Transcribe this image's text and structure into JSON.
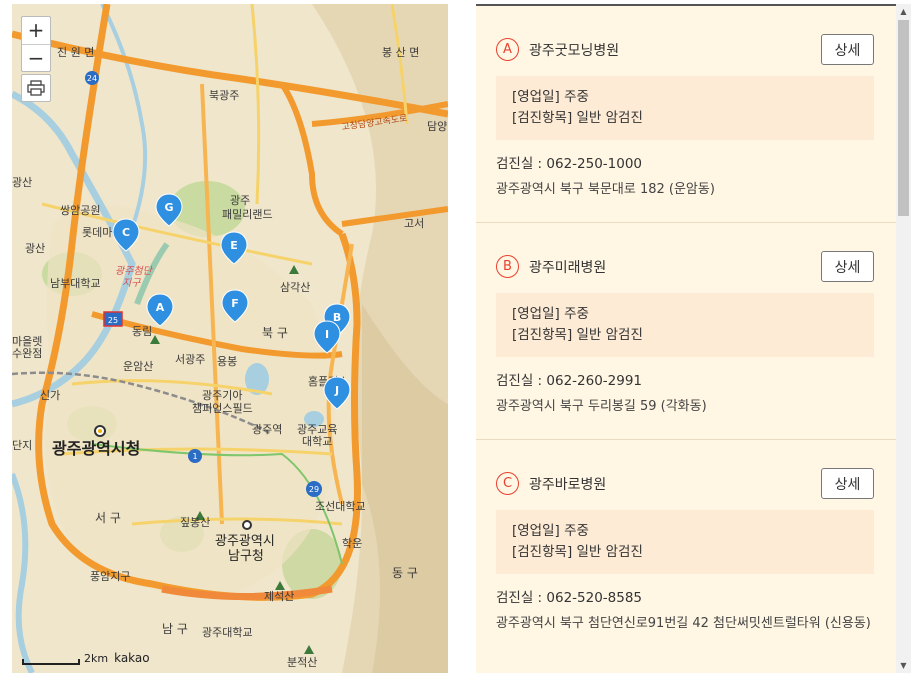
{
  "map": {
    "zoom_in": "+",
    "zoom_out": "−",
    "scale_label": "2km",
    "provider": "kakao",
    "labels": [
      {
        "text": "진 원 면"
      },
      {
        "text": "봉 산 면"
      },
      {
        "text": "북광주"
      },
      {
        "text": "고창담양고속도로"
      },
      {
        "text": "담양"
      },
      {
        "text": "쌍암공원"
      },
      {
        "text": "광주"
      },
      {
        "text": "패밀리랜드"
      },
      {
        "text": "롯데마트"
      },
      {
        "text": "고서"
      },
      {
        "text": "광주첨단"
      },
      {
        "text": "지구"
      },
      {
        "text": "남부대학교"
      },
      {
        "text": "삼각산"
      },
      {
        "text": "동림"
      },
      {
        "text": "북 구"
      },
      {
        "text": "서광주"
      },
      {
        "text": "용봉"
      },
      {
        "text": "운암산"
      },
      {
        "text": "홈플러스"
      },
      {
        "text": "광주기아"
      },
      {
        "text": "챔피언스필드"
      },
      {
        "text": "광주역"
      },
      {
        "text": "광주교육"
      },
      {
        "text": "대학교"
      },
      {
        "text": "광주광역시청"
      },
      {
        "text": "서 구"
      },
      {
        "text": "조선대학교"
      },
      {
        "text": "짚봉산"
      },
      {
        "text": "광주광역시"
      },
      {
        "text": "남구청"
      },
      {
        "text": "학운"
      },
      {
        "text": "풍암지구"
      },
      {
        "text": "동 구"
      },
      {
        "text": "제석산"
      },
      {
        "text": "남 구"
      },
      {
        "text": "광주대학교"
      },
      {
        "text": "분적산"
      },
      {
        "text": "신가"
      },
      {
        "text": "광산"
      },
      {
        "text": "마을렛"
      },
      {
        "text": "수완점"
      },
      {
        "text": "광산"
      },
      {
        "text": "단지"
      }
    ],
    "route_numbers": [
      "24",
      "25",
      "1",
      "29"
    ],
    "markers": [
      "A",
      "B",
      "C",
      "E",
      "F",
      "G",
      "I",
      "J"
    ]
  },
  "hospitals": [
    {
      "marker": "A",
      "name": "광주굿모닝병원",
      "detail_label": "상세",
      "open_days": "[영업일] 주중",
      "exam_items": "[검진항목] 일반 암검진",
      "phone": "검진실 :  062-250-1000",
      "address": "광주광역시 북구 북문대로 182 (운암동)"
    },
    {
      "marker": "B",
      "name": "광주미래병원",
      "detail_label": "상세",
      "open_days": "[영업일] 주중",
      "exam_items": "[검진항목] 일반 암검진",
      "phone": "검진실 :  062-260-2991",
      "address": "광주광역시 북구 두리봉길 59 (각화동)"
    },
    {
      "marker": "C",
      "name": "광주바로병원",
      "detail_label": "상세",
      "open_days": "[영업일] 주중",
      "exam_items": "[검진항목] 일반 암검진",
      "phone": "검진실 :  062-520-8585",
      "address": "광주광역시 북구 첨단연신로91번길 42 첨단써밋센트럴타워 (신용동)"
    }
  ],
  "colors": {
    "marker_blue": "#2f8fe0",
    "badge_red": "#e8412e",
    "highway_orange": "#f29a2e",
    "panel_bg": "#fff7e4",
    "info_bg": "#fdebd6"
  }
}
